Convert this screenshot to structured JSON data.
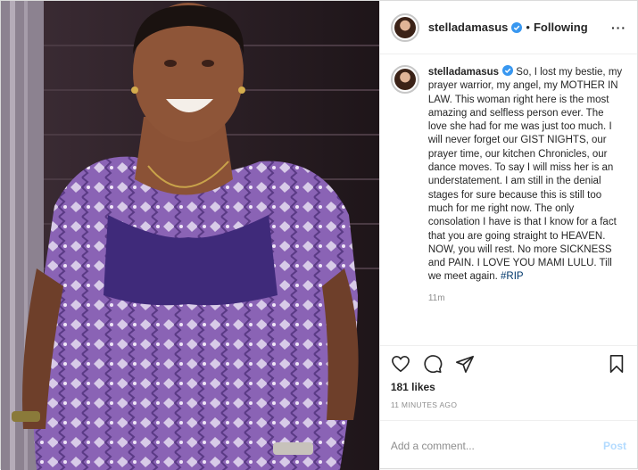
{
  "post": {
    "photo_alt": "",
    "header": {
      "username": "stelladamasus",
      "separator": "•",
      "follow_label": "Following",
      "more_label": "···"
    },
    "caption": {
      "username": "stelladamasus",
      "text": " So, I lost my bestie, my prayer warrior, my angel, my MOTHER IN LAW. This woman right here is the most amazing and selfless person ever. The love she had for me was just too much. I will never forget our GIST NIGHTS, our prayer time, our kitchen Chronicles, our dance moves. To say I will miss her is an understatement. I am still in the denial stages for sure because this is still too much for me right now. The only consolation I have is that I know for a fact that you are going straight to HEAVEN. NOW, you will rest. No more SICKNESS and PAIN. I LOVE YOU MAMI LULU. Till we meet again. ",
      "hashtag": "#RIP",
      "time": "11m"
    },
    "actions": {
      "like_icon": "heart-icon",
      "comment_icon": "comment-icon",
      "share_icon": "share-icon",
      "save_icon": "bookmark-icon"
    },
    "likes": "181 likes",
    "posted_ago": "11 MINUTES AGO",
    "comment_box": {
      "placeholder": "Add a comment...",
      "post_label": "Post"
    },
    "colors": {
      "verified": "#3897f0",
      "link": "#00376b",
      "post_disabled": "#b3dbff",
      "dress_purple": "#7a4fa6"
    }
  }
}
